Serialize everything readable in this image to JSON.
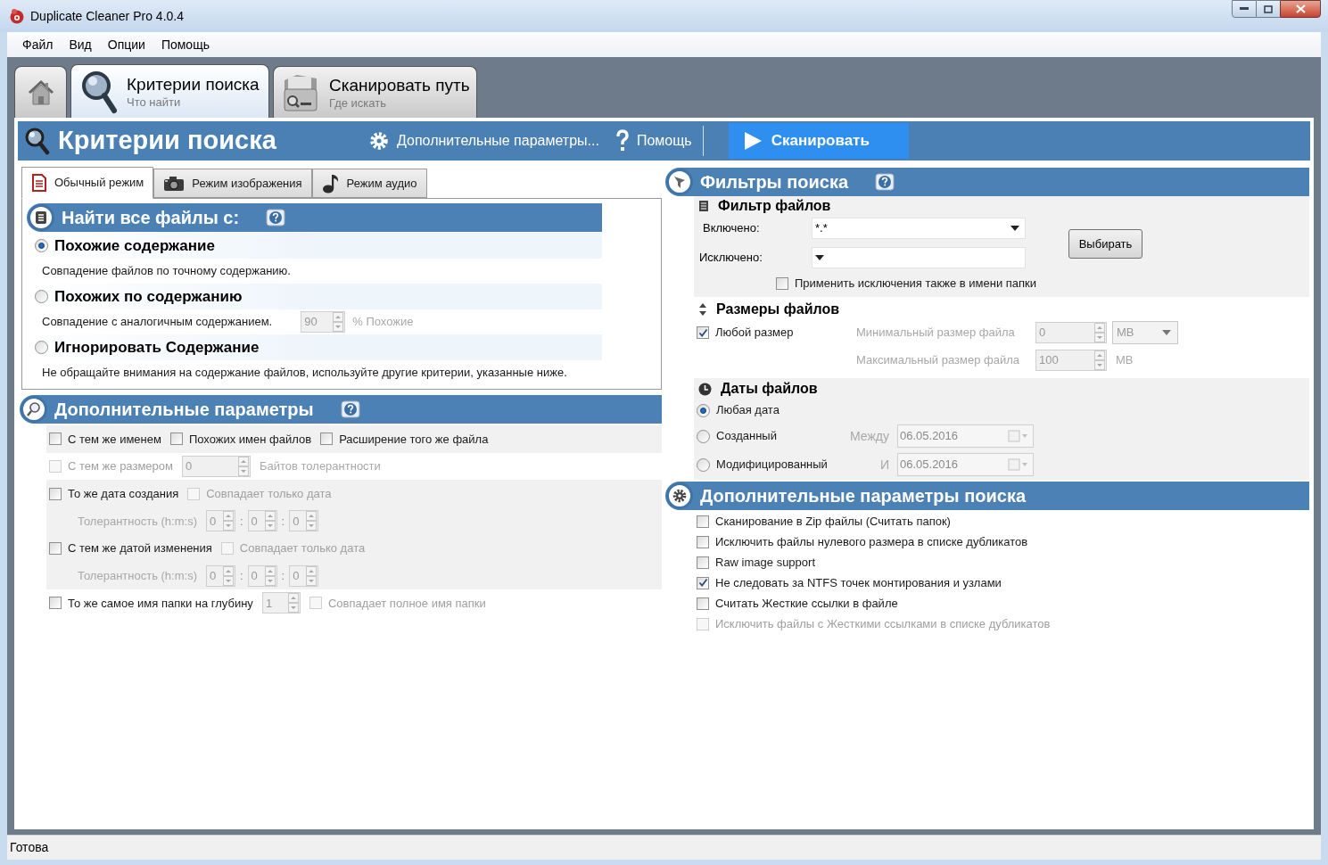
{
  "window": {
    "title": "Duplicate Cleaner Pro 4.0.4"
  },
  "menu": [
    "Файл",
    "Вид",
    "Опции",
    "Помощь"
  ],
  "main_tabs": [
    {
      "kind": "home",
      "selected": false
    },
    {
      "kind": "search",
      "title": "Критерии поиска",
      "subtitle": "Что найти",
      "selected": true
    },
    {
      "kind": "scan",
      "title": "Сканировать путь",
      "subtitle": "Где искать",
      "selected": false
    }
  ],
  "header": {
    "title": "Критерии поиска",
    "more": "Дополнительные параметры...",
    "help": "Помощь",
    "scan": "Сканировать"
  },
  "mode_tabs": [
    {
      "kind": "document",
      "label": "Обычный режим",
      "selected": true
    },
    {
      "kind": "camera",
      "label": "Режим изображения",
      "selected": false
    },
    {
      "kind": "music",
      "label": "Режим аудио",
      "selected": false
    }
  ],
  "find_all": {
    "title": "Найти все файлы с:",
    "options": [
      {
        "label": "Похожие содержание",
        "description": "Совпадение файлов по точному содержанию.",
        "selected": true
      },
      {
        "label": "Похожих по содержанию",
        "description": "Совпадение с аналогичным содержанием.",
        "selected": false,
        "similarity": {
          "value": "90",
          "unit": "% Похожие",
          "disabled": true
        }
      },
      {
        "label": "Игнорировать Содержание",
        "description": "Не обращайте внимания на содержание файлов, используйте другие критерии, указанные ниже.",
        "selected": false
      }
    ]
  },
  "additional": {
    "title": "Дополнительные параметры",
    "rows": [
      {
        "kind": "check",
        "shaded": true,
        "items": [
          {
            "kind": "checkbox",
            "label": "С тем же именем",
            "checked": false,
            "disabled": false
          },
          {
            "kind": "checkbox",
            "label": "Похожих имен файлов",
            "checked": false,
            "disabled": false
          },
          {
            "kind": "checkbox",
            "label": "Расширение того же файла",
            "checked": false,
            "disabled": false
          }
        ]
      },
      {
        "kind": "check",
        "shaded": false,
        "items": [
          {
            "kind": "checkbox",
            "label": "С тем же размером",
            "checked": false,
            "disabled": true
          },
          {
            "kind": "spinner",
            "value": "0",
            "disabled": true
          },
          {
            "kind": "label",
            "text": "Байтов толерантности",
            "disabled": true
          }
        ]
      },
      {
        "kind": "check",
        "shaded": true,
        "items": [
          {
            "kind": "checkbox",
            "label": "То же дата создания",
            "checked": false,
            "disabled": false
          },
          {
            "kind": "checkbox",
            "label": "Совпадает только дата",
            "checked": false,
            "disabled": true
          }
        ]
      },
      {
        "kind": "tolerance",
        "shaded": true,
        "items": [
          {
            "kind": "label",
            "text": "Толерантность (h:m:s)",
            "disabled": true
          },
          {
            "kind": "spinner",
            "value": "0",
            "disabled": true
          },
          {
            "kind": "separator",
            "text": ":"
          },
          {
            "kind": "spinner",
            "value": "0",
            "disabled": true
          },
          {
            "kind": "separator",
            "text": ":"
          },
          {
            "kind": "spinner",
            "value": "0",
            "disabled": true
          }
        ]
      },
      {
        "kind": "check",
        "shaded": true,
        "items": [
          {
            "kind": "checkbox",
            "label": "С тем же датой изменения",
            "checked": false,
            "disabled": false
          },
          {
            "kind": "checkbox",
            "label": "Совпадает только дата",
            "checked": false,
            "disabled": true
          }
        ]
      },
      {
        "kind": "tolerance",
        "shaded": true,
        "items": [
          {
            "kind": "label",
            "text": "Толерантность (h:m:s)",
            "disabled": true
          },
          {
            "kind": "spinner",
            "value": "0",
            "disabled": true
          },
          {
            "kind": "separator",
            "text": ":"
          },
          {
            "kind": "spinner",
            "value": "0",
            "disabled": true
          },
          {
            "kind": "separator",
            "text": ":"
          },
          {
            "kind": "spinner",
            "value": "0",
            "disabled": true
          }
        ]
      },
      {
        "kind": "check",
        "shaded": false,
        "items": [
          {
            "kind": "checkbox",
            "label": "То же самое имя папки на глубину",
            "checked": false,
            "disabled": false
          },
          {
            "kind": "spinner",
            "value": "1",
            "disabled": true
          },
          {
            "kind": "checkbox",
            "label": "Совпадает полное имя папки",
            "checked": false,
            "disabled": true
          }
        ]
      }
    ]
  },
  "search_filters": {
    "title": "Фильтры поиска",
    "file_filter": {
      "title": "Фильтр файлов",
      "included": {
        "label": "Включено:",
        "value": "*.*"
      },
      "excluded": {
        "label": "Исключено:"
      },
      "button": "Выбирать",
      "apply_to_folders": {
        "label": "Применить исключения также в имени папки",
        "checked": false
      }
    },
    "file_sizes": {
      "title": "Размеры файлов",
      "any_size": {
        "label": "Любой размер",
        "checked": true
      },
      "min": {
        "label": "Минимальный размер файла",
        "value": "0",
        "unit": "MB",
        "disabled": true
      },
      "max": {
        "label": "Максимальный размер файла",
        "value": "100",
        "unit": "MB",
        "disabled": true
      }
    },
    "file_dates": {
      "title": "Даты файлов",
      "options": [
        {
          "label": "Любая дата",
          "selected": true
        },
        {
          "label": "Созданный",
          "selected": false,
          "range_label": "Между",
          "date": "06.05.2016",
          "disabled": true
        },
        {
          "label": "Модифицированный",
          "selected": false,
          "range_label": "И",
          "date": "06.05.2016",
          "disabled": true
        }
      ]
    }
  },
  "advanced_search": {
    "title": "Дополнительные параметры поиска",
    "options": [
      {
        "label": "Сканирование в Zip файлы (Считать папок)",
        "checked": false,
        "disabled": false
      },
      {
        "label": "Исключить файлы нулевого размера в списке дубликатов",
        "checked": false,
        "disabled": false
      },
      {
        "label": "Raw image support",
        "checked": false,
        "disabled": false
      },
      {
        "label": "Не следовать за NTFS точек монтирования и узлами",
        "checked": true,
        "disabled": false
      },
      {
        "label": "Считать Жесткие ссылки в файле",
        "checked": false,
        "disabled": false
      },
      {
        "label": "Исключить файлы с Жесткими ссылками в списке дубликатов",
        "checked": false,
        "disabled": true
      }
    ]
  },
  "status_bar": "Готова"
}
